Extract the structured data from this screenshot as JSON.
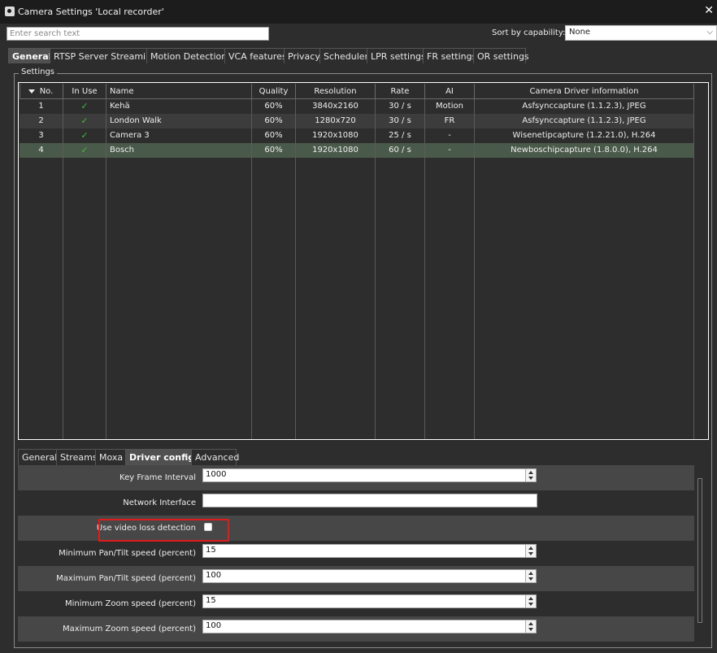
{
  "window": {
    "title": "Camera Settings 'Local recorder'",
    "icon": "camera-settings-icon",
    "close_icon": "close-icon"
  },
  "search": {
    "placeholder": "Enter search text",
    "value": ""
  },
  "sort": {
    "label": "Sort by capability:",
    "value": "None"
  },
  "tabs": [
    {
      "label": "General",
      "active": true
    },
    {
      "label": "RTSP Server Streaming"
    },
    {
      "label": "Motion Detection"
    },
    {
      "label": "VCA features"
    },
    {
      "label": "Privacy"
    },
    {
      "label": "Scheduler"
    },
    {
      "label": "LPR settings"
    },
    {
      "label": "FR settings"
    },
    {
      "label": "OR settings"
    }
  ],
  "settings": {
    "legend": "Settings",
    "columns": [
      "No.",
      "In Use",
      "Name",
      "Quality",
      "Resolution",
      "Rate",
      "AI",
      "Camera Driver information"
    ],
    "rows": [
      {
        "no": "1",
        "in_use": "✓",
        "name": "Kehä",
        "quality": "60%",
        "resolution": "3840x2160",
        "rate": "30 / s",
        "ai": "Motion",
        "driver": "Asfsynccapture (1.1.2.3), JPEG"
      },
      {
        "no": "2",
        "in_use": "✓",
        "name": "London Walk",
        "quality": "60%",
        "resolution": "1280x720",
        "rate": "30 / s",
        "ai": "FR",
        "driver": "Asfsynccapture (1.1.2.3), JPEG"
      },
      {
        "no": "3",
        "in_use": "✓",
        "name": "Camera 3",
        "quality": "60%",
        "resolution": "1920x1080",
        "rate": "25 / s",
        "ai": "-",
        "driver": "Wisenetipcapture (1.2.21.0), H.264"
      },
      {
        "no": "4",
        "in_use": "✓",
        "name": "Bosch",
        "quality": "60%",
        "resolution": "1920x1080",
        "rate": "60 / s",
        "ai": "-",
        "driver": "Newboschipcapture (1.8.0.0), H.264",
        "selected": true
      }
    ]
  },
  "subtabs": [
    {
      "label": "General"
    },
    {
      "label": "Streams"
    },
    {
      "label": "Moxa"
    },
    {
      "label": "Driver config",
      "active": true
    },
    {
      "label": "Advanced"
    }
  ],
  "driver_config": {
    "key_frame_interval": {
      "label": "Key Frame Interval",
      "value": "1000"
    },
    "network_interface": {
      "label": "Network Interface",
      "value": ""
    },
    "video_loss_detection": {
      "label": "Use video loss detection",
      "checked": false
    },
    "min_pan_tilt": {
      "label": "Minimum Pan/Tilt speed (percent)",
      "value": "15"
    },
    "max_pan_tilt": {
      "label": "Maximum Pan/Tilt speed (percent)",
      "value": "100"
    },
    "min_zoom": {
      "label": "Minimum Zoom speed (percent)",
      "value": "15"
    },
    "max_zoom": {
      "label": "Maximum Zoom speed (percent)",
      "value": "100"
    }
  },
  "colors": {
    "background": "#2d2d2d",
    "selected_row": "#4a5a4a",
    "check": "#3cbd3c",
    "highlight": "#e01b1b"
  }
}
